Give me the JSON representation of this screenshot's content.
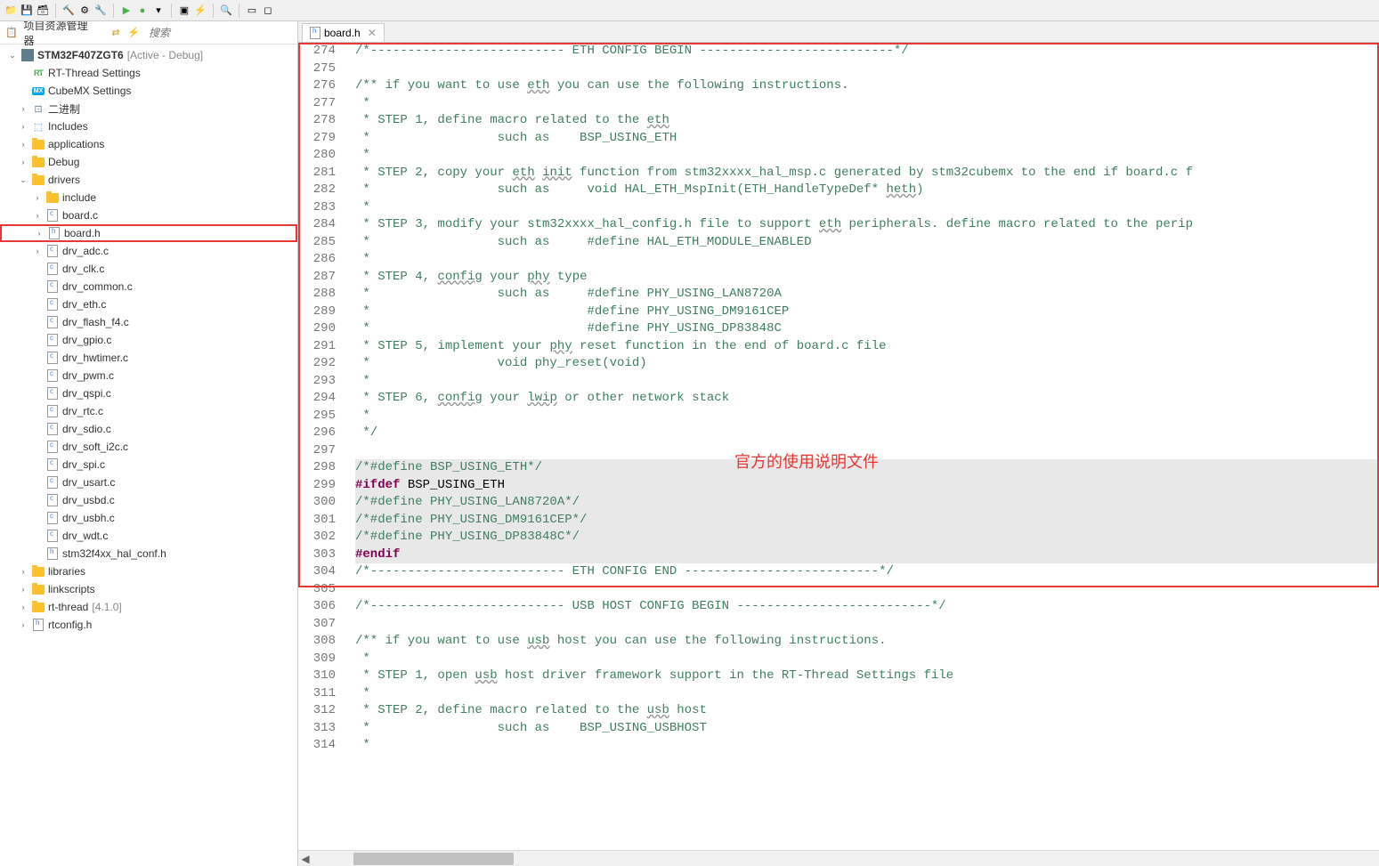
{
  "sidebar": {
    "title": "项目资源管理器",
    "search_placeholder": "搜索",
    "project": {
      "name": "STM32F407ZGT6",
      "status": "[Active - Debug]"
    },
    "items": [
      {
        "name": "RT-Thread Settings",
        "icon": "rt"
      },
      {
        "name": "CubeMX Settings",
        "icon": "mx"
      },
      {
        "name": "二进制",
        "icon": "bin",
        "toggle": ">"
      },
      {
        "name": "Includes",
        "icon": "inc",
        "toggle": ">"
      },
      {
        "name": "applications",
        "icon": "folder",
        "toggle": ">"
      },
      {
        "name": "Debug",
        "icon": "folder",
        "toggle": ">"
      },
      {
        "name": "drivers",
        "icon": "folder",
        "toggle": "v",
        "children": [
          {
            "name": "include",
            "icon": "folder",
            "toggle": ">"
          },
          {
            "name": "board.c",
            "icon": "c",
            "toggle": ">"
          },
          {
            "name": "board.h",
            "icon": "h",
            "toggle": ">",
            "highlighted": true
          },
          {
            "name": "drv_adc.c",
            "icon": "c",
            "toggle": ">"
          },
          {
            "name": "drv_clk.c",
            "icon": "c"
          },
          {
            "name": "drv_common.c",
            "icon": "c"
          },
          {
            "name": "drv_eth.c",
            "icon": "c"
          },
          {
            "name": "drv_flash_f4.c",
            "icon": "c"
          },
          {
            "name": "drv_gpio.c",
            "icon": "c"
          },
          {
            "name": "drv_hwtimer.c",
            "icon": "c"
          },
          {
            "name": "drv_pwm.c",
            "icon": "c"
          },
          {
            "name": "drv_qspi.c",
            "icon": "c"
          },
          {
            "name": "drv_rtc.c",
            "icon": "c"
          },
          {
            "name": "drv_sdio.c",
            "icon": "c"
          },
          {
            "name": "drv_soft_i2c.c",
            "icon": "c"
          },
          {
            "name": "drv_spi.c",
            "icon": "c"
          },
          {
            "name": "drv_usart.c",
            "icon": "c"
          },
          {
            "name": "drv_usbd.c",
            "icon": "c"
          },
          {
            "name": "drv_usbh.c",
            "icon": "c"
          },
          {
            "name": "drv_wdt.c",
            "icon": "c"
          },
          {
            "name": "stm32f4xx_hal_conf.h",
            "icon": "h"
          }
        ]
      },
      {
        "name": "libraries",
        "icon": "folder",
        "toggle": ">"
      },
      {
        "name": "linkscripts",
        "icon": "folder",
        "toggle": ">"
      },
      {
        "name": "rt-thread",
        "icon": "folder",
        "toggle": ">",
        "extra": "[4.1.0]"
      },
      {
        "name": "rtconfig.h",
        "icon": "h",
        "toggle": ">"
      }
    ]
  },
  "tab": {
    "label": "board.h"
  },
  "annotation": "官方的使用说明文件",
  "code": {
    "start": 274,
    "lines": [
      {
        "t": "/*-------------------------- ETH CONFIG BEGIN --------------------------*/",
        "c": "comment"
      },
      {
        "t": "",
        "c": ""
      },
      {
        "t": "/** if you want to use eth you can use the following instructions.",
        "c": "comment",
        "u": [
          "eth"
        ]
      },
      {
        "t": " *",
        "c": "comment"
      },
      {
        "t": " * STEP 1, define macro related to the eth",
        "c": "comment",
        "u": [
          "eth"
        ]
      },
      {
        "t": " *                 such as    BSP_USING_ETH",
        "c": "comment"
      },
      {
        "t": " *",
        "c": "comment"
      },
      {
        "t": " * STEP 2, copy your eth init function from stm32xxxx_hal_msp.c generated by stm32cubemx to the end if board.c f",
        "c": "comment",
        "u": [
          "eth",
          "init"
        ]
      },
      {
        "t": " *                 such as     void HAL_ETH_MspInit(ETH_HandleTypeDef* heth)",
        "c": "comment",
        "u": [
          "heth"
        ]
      },
      {
        "t": " *",
        "c": "comment"
      },
      {
        "t": " * STEP 3, modify your stm32xxxx_hal_config.h file to support eth peripherals. define macro related to the perip",
        "c": "comment",
        "u": [
          "eth"
        ]
      },
      {
        "t": " *                 such as     #define HAL_ETH_MODULE_ENABLED",
        "c": "comment"
      },
      {
        "t": " *",
        "c": "comment"
      },
      {
        "t": " * STEP 4, config your phy type",
        "c": "comment",
        "u": [
          "config",
          "phy"
        ]
      },
      {
        "t": " *                 such as     #define PHY_USING_LAN8720A",
        "c": "comment"
      },
      {
        "t": " *                             #define PHY_USING_DM9161CEP",
        "c": "comment"
      },
      {
        "t": " *                             #define PHY_USING_DP83848C",
        "c": "comment"
      },
      {
        "t": " * STEP 5, implement your phy reset function in the end of board.c file",
        "c": "comment",
        "u": [
          "phy"
        ]
      },
      {
        "t": " *                 void phy_reset(void)",
        "c": "comment"
      },
      {
        "t": " *",
        "c": "comment"
      },
      {
        "t": " * STEP 6, config your lwip or other network stack",
        "c": "comment",
        "u": [
          "config",
          "lwip"
        ]
      },
      {
        "t": " *",
        "c": "comment"
      },
      {
        "t": " */",
        "c": "comment"
      },
      {
        "t": "",
        "c": ""
      },
      {
        "t": "/*#define BSP_USING_ETH*/",
        "c": "comment",
        "hl": true
      },
      {
        "t": "#ifdef BSP_USING_ETH",
        "c": "ifdef",
        "hl": true
      },
      {
        "t": "/*#define PHY_USING_LAN8720A*/",
        "c": "comment",
        "hl": true
      },
      {
        "t": "/*#define PHY_USING_DM9161CEP*/",
        "c": "comment",
        "hl": true
      },
      {
        "t": "/*#define PHY_USING_DP83848C*/",
        "c": "comment",
        "hl": true
      },
      {
        "t": "#endif",
        "c": "keyword",
        "hl": true
      },
      {
        "t": "/*-------------------------- ETH CONFIG END --------------------------*/",
        "c": "comment"
      },
      {
        "t": "",
        "c": ""
      },
      {
        "t": "/*-------------------------- USB HOST CONFIG BEGIN --------------------------*/",
        "c": "comment"
      },
      {
        "t": "",
        "c": ""
      },
      {
        "t": "/** if you want to use usb host you can use the following instructions.",
        "c": "comment",
        "u": [
          "usb"
        ]
      },
      {
        "t": " *",
        "c": "comment"
      },
      {
        "t": " * STEP 1, open usb host driver framework support in the RT-Thread Settings file",
        "c": "comment",
        "u": [
          "usb"
        ]
      },
      {
        "t": " *",
        "c": "comment"
      },
      {
        "t": " * STEP 2, define macro related to the usb host",
        "c": "comment",
        "u": [
          "usb"
        ]
      },
      {
        "t": " *                 such as    BSP_USING_USBHOST",
        "c": "comment"
      },
      {
        "t": " *",
        "c": "comment"
      }
    ]
  }
}
